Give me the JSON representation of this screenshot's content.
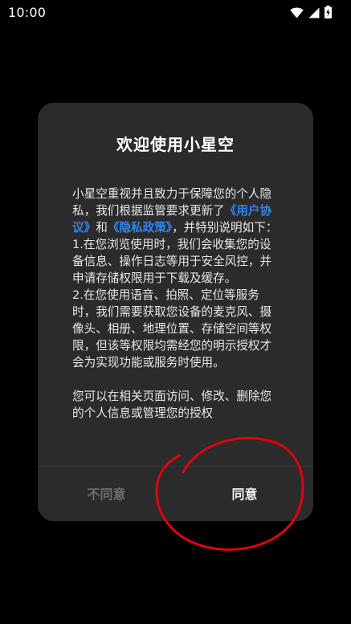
{
  "status_bar": {
    "time": "10:00",
    "icons": [
      "wifi-icon",
      "cellular-signal-icon",
      "battery-charging-icon"
    ]
  },
  "dialog": {
    "title": "欢迎使用小星空",
    "intro_before": "小星空重视并且致力于保障您的个人隐私，我们根据监管要求更新了",
    "user_agreement_link": "《用户协议》",
    "and_text": "和",
    "privacy_policy_link": "《隐私政策》",
    "intro_after": "，并特别说明如下：",
    "point_1": "1.在您浏览使用时，我们会收集您的设备信息、操作日志等用于安全风控，并申请存储权限用于下载及缓存。",
    "point_2": "2.在您使用语音、拍照、定位等服务时，我们需要获取您设备的麦克风、摄像头、相册、地理位置、存储空间等权限，但该等权限均需经您的明示授权才会为实现功能或服务时使用。",
    "footer_text": "您可以在相关页面访问、修改、删除您的个人信息或管理您的授权",
    "disagree_label": "不同意",
    "agree_label": "同意"
  },
  "colors": {
    "background": "#000000",
    "dialog": "#2b2b2b",
    "link": "#2f86f0",
    "annotation_circle": "#e0000f"
  }
}
